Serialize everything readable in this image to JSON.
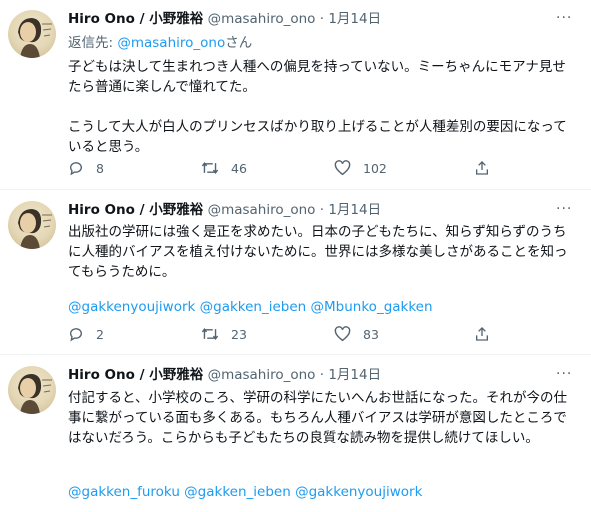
{
  "tweets": [
    {
      "author": "Hiro Ono / 小野雅裕",
      "handle": "@masahiro_ono",
      "dot": "·",
      "date": "1月14日",
      "more": "···",
      "reply_prefix": "返信先: ",
      "reply_handle": "@masahiro_ono",
      "reply_suffix": "さん",
      "paragraphs": [
        "子どもは決して生まれつき人種への偏見を持っていない。ミーちゃんにモアナ見せたら普通に楽しんで憧れてた。",
        "こうして大人が白人のプリンセスばかり取り上げることが人種差別の要因になっていると思う。"
      ],
      "tags": "",
      "counts": {
        "reply": "8",
        "retweet": "46",
        "like": "102"
      }
    },
    {
      "author": "Hiro Ono / 小野雅裕",
      "handle": "@masahiro_ono",
      "dot": "·",
      "date": "1月14日",
      "more": "···",
      "paragraphs": [
        "出版社の学研には強く是正を求めたい。日本の子どもたちに、知らず知らずのうちに人種的バイアスを植え付けないために。世界には多様な美しさがあることを知ってもらうために。"
      ],
      "tags": "@gakkenyoujiwork @gakken_ieben @Mbunko_gakken",
      "counts": {
        "reply": "2",
        "retweet": "23",
        "like": "83"
      }
    },
    {
      "author": "Hiro Ono / 小野雅裕",
      "handle": "@masahiro_ono",
      "dot": "·",
      "date": "1月14日",
      "more": "···",
      "paragraphs": [
        "付記すると、小学校のころ、学研の科学にたいへんお世話になった。それが今の仕事に繋がっている面も多くある。もちろん人種バイアスは学研が意図したところではないだろう。こらからも子どもたちの良質な読み物を提供し続けてほしい。"
      ],
      "tags": "@gakken_furoku @gakken_ieben @gakkenyoujiwork"
    }
  ]
}
